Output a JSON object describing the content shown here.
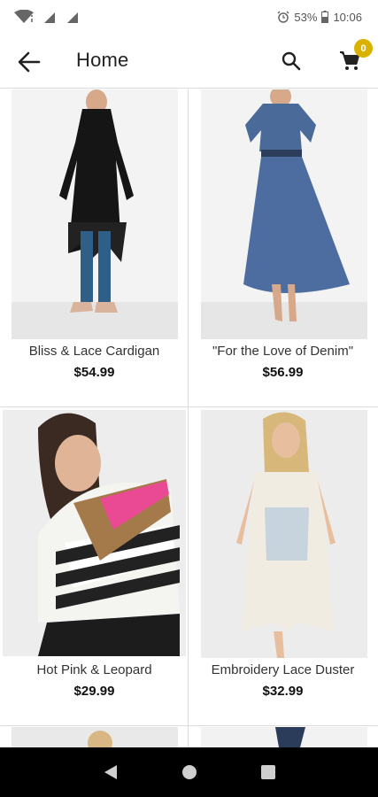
{
  "status_bar": {
    "battery": "53%",
    "time": "10:06"
  },
  "app_bar": {
    "title": "Home",
    "cart_count": "0",
    "icons": [
      "back-arrow-icon",
      "search-icon",
      "cart-icon"
    ]
  },
  "products": [
    {
      "name": "Bliss & Lace Cardigan",
      "price": "$54.99"
    },
    {
      "name": "\"For the Love of Denim\"",
      "price": "$56.99"
    },
    {
      "name": "Hot Pink & Leopard",
      "price": "$29.99"
    },
    {
      "name": "Embroidery Lace Duster",
      "price": "$32.99"
    }
  ],
  "colors": {
    "badge": "#d9b200",
    "nav_bar": "#000000",
    "divider": "#dcdcdc"
  }
}
